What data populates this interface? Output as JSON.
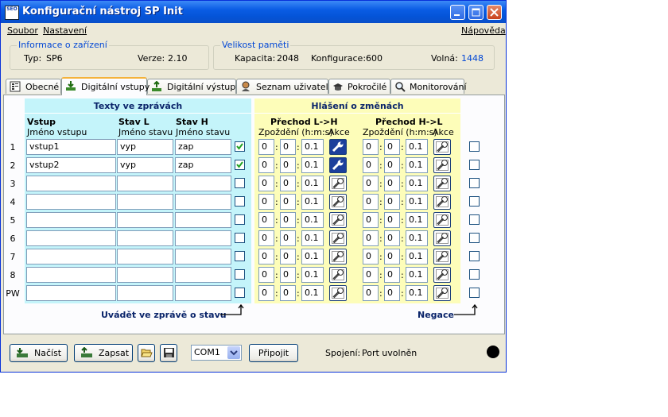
{
  "window": {
    "title": "Konfigurační nástroj SP Init",
    "app_icon": "SEO"
  },
  "menu": {
    "file": "Soubor",
    "settings": "Nastavení",
    "help": "Nápověda"
  },
  "device_info": {
    "legend": "Informace o zařízení",
    "type_label": "Typ:",
    "type_value": "SP6",
    "version_label": "Verze:",
    "version_value": "2.10"
  },
  "memory": {
    "legend": "Velikost paměti",
    "capacity_label": "Kapacita:",
    "capacity_value": "2048",
    "config_label": "Konfigurace:",
    "config_value": "600",
    "free_label": "Volná:",
    "free_value": "1448"
  },
  "tabs": [
    {
      "label": "Obecné",
      "icon": "general-icon"
    },
    {
      "label": "Digitální vstupy",
      "icon": "digital-input-icon",
      "active": true
    },
    {
      "label": "Digitální výstupy",
      "icon": "digital-output-icon"
    },
    {
      "label": "Seznam uživatelů",
      "icon": "users-icon"
    },
    {
      "label": "Pokročilé",
      "icon": "hat-icon"
    },
    {
      "label": "Monitorování",
      "icon": "magnifier-icon"
    }
  ],
  "messages_section": {
    "title": "Texty ve zprávách",
    "col_input": "Vstup",
    "col_input_sub": "Jméno vstupu",
    "col_l": "Stav L",
    "col_l_sub": "Jméno stavu",
    "col_h": "Stav H",
    "col_h_sub": "Jméno stavu"
  },
  "changes_section": {
    "title": "Hlášení o změnách",
    "lh_title": "Přechod L->H",
    "hl_title": "Přechod H->L",
    "delay_label": "Zpoždění (h:m:s)",
    "action_label": "Akce"
  },
  "rows": [
    {
      "num": "1",
      "name": "vstup1",
      "l": "vyp",
      "h": "zap",
      "report": true,
      "lh": [
        "0",
        "0",
        "0.1"
      ],
      "lh_action": true,
      "hl": [
        "0",
        "0",
        "0.1"
      ],
      "hl_action": false,
      "neg": false
    },
    {
      "num": "2",
      "name": "vstup2",
      "l": "vyp",
      "h": "zap",
      "report": true,
      "lh": [
        "0",
        "0",
        "0.1"
      ],
      "lh_action": true,
      "hl": [
        "0",
        "0",
        "0.1"
      ],
      "hl_action": false,
      "neg": false
    },
    {
      "num": "3",
      "name": "",
      "l": "",
      "h": "",
      "report": false,
      "lh": [
        "0",
        "0",
        "0.1"
      ],
      "lh_action": false,
      "hl": [
        "0",
        "0",
        "0.1"
      ],
      "hl_action": false,
      "neg": false
    },
    {
      "num": "4",
      "name": "",
      "l": "",
      "h": "",
      "report": false,
      "lh": [
        "0",
        "0",
        "0.1"
      ],
      "lh_action": false,
      "hl": [
        "0",
        "0",
        "0.1"
      ],
      "hl_action": false,
      "neg": false
    },
    {
      "num": "5",
      "name": "",
      "l": "",
      "h": "",
      "report": false,
      "lh": [
        "0",
        "0",
        "0.1"
      ],
      "lh_action": false,
      "hl": [
        "0",
        "0",
        "0.1"
      ],
      "hl_action": false,
      "neg": false
    },
    {
      "num": "6",
      "name": "",
      "l": "",
      "h": "",
      "report": false,
      "lh": [
        "0",
        "0",
        "0.1"
      ],
      "lh_action": false,
      "hl": [
        "0",
        "0",
        "0.1"
      ],
      "hl_action": false,
      "neg": false
    },
    {
      "num": "7",
      "name": "",
      "l": "",
      "h": "",
      "report": false,
      "lh": [
        "0",
        "0",
        "0.1"
      ],
      "lh_action": false,
      "hl": [
        "0",
        "0",
        "0.1"
      ],
      "hl_action": false,
      "neg": false
    },
    {
      "num": "8",
      "name": "",
      "l": "",
      "h": "",
      "report": false,
      "lh": [
        "0",
        "0",
        "0.1"
      ],
      "lh_action": false,
      "hl": [
        "0",
        "0",
        "0.1"
      ],
      "hl_action": false,
      "neg": false
    },
    {
      "num": "PW",
      "name": "",
      "l": "",
      "h": "",
      "report": false,
      "lh": [
        "0",
        "0",
        "0.1"
      ],
      "lh_action": false,
      "hl": [
        "0",
        "0",
        "0.1"
      ],
      "hl_action": false,
      "neg": false
    }
  ],
  "notes": {
    "report_in_message": "Uvádět ve zprávě o stavu",
    "negation": "Negace"
  },
  "bottom": {
    "load_label": "Načíst",
    "write_label": "Zapsat",
    "open_icon": "folder-open-icon",
    "save_icon": "floppy-icon",
    "port_value": "COM1",
    "connect_label": "Připojit",
    "connection_label": "Spojení:",
    "connection_value": "Port uvolněn"
  },
  "colors": {
    "accent_blue": "#0046d5",
    "messages_bg": "#c4f4fa",
    "changes_bg": "#fdfdb9",
    "active_action": "#1c3f9c"
  }
}
